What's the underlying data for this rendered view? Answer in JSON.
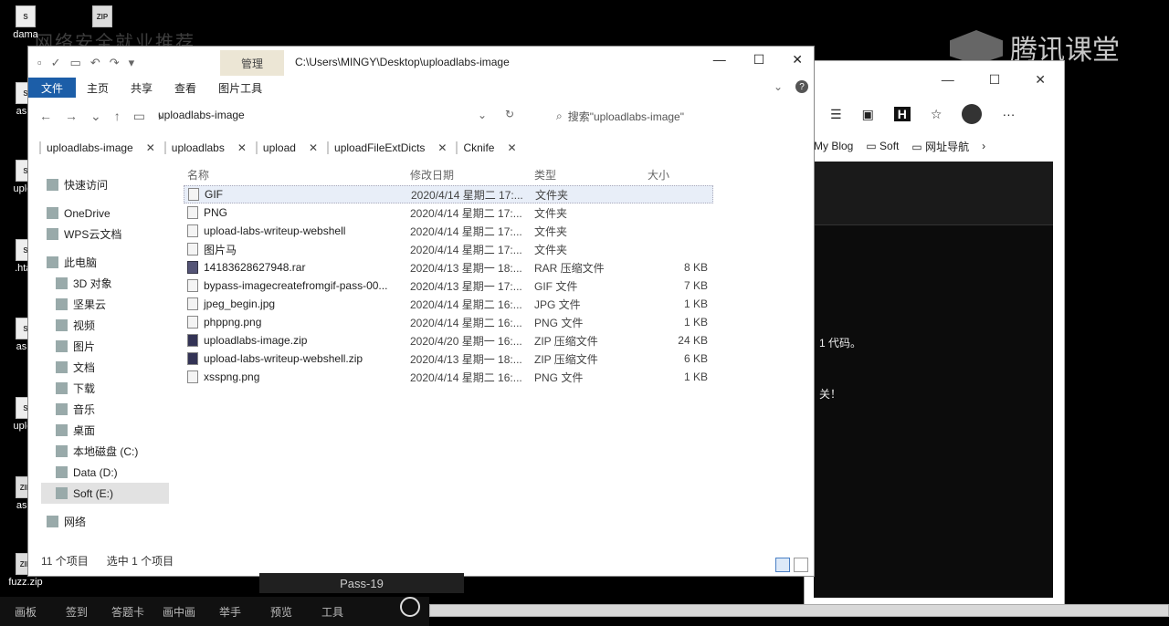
{
  "desktop": {
    "icons": [
      {
        "label": "dama",
        "type": "S"
      },
      {
        "label": "",
        "type": "ZIP"
      },
      {
        "label": "as.p",
        "type": "S"
      },
      {
        "label": "uploa",
        "type": "S"
      },
      {
        "label": ".htac",
        "type": "S"
      },
      {
        "label": "as.p",
        "type": "S"
      },
      {
        "label": "uploa",
        "type": "S"
      },
      {
        "label": "as.z",
        "type": "ZIP"
      },
      {
        "label": "fuzz.zip",
        "type": "ZIP"
      }
    ],
    "watermark": "网络安全就业推荐",
    "brand": "腾讯课堂"
  },
  "explorer": {
    "quick_access": [
      "▫",
      "✓",
      "▭",
      "↶",
      "↷",
      "▾"
    ],
    "manage_tab": "管理",
    "title_path": "C:\\Users\\MINGY\\Desktop\\uploadlabs-image",
    "window_buttons": [
      "—",
      "☐",
      "✕"
    ],
    "ribbon_tabs": [
      "文件",
      "主页",
      "共享",
      "查看",
      "图片工具"
    ],
    "address": "uploadlabs-image",
    "search_placeholder": "搜索\"uploadlabs-image\"",
    "folder_tabs": [
      "uploadlabs-image",
      "uploadlabs",
      "upload",
      "uploadFileExtDicts",
      "Cknife"
    ],
    "sidebar": [
      {
        "label": "快速访问",
        "selected": false
      },
      {
        "label": "OneDrive",
        "selected": false
      },
      {
        "label": "WPS云文档",
        "selected": false
      },
      {
        "label": "此电脑",
        "selected": false
      },
      {
        "label": "3D 对象",
        "selected": false
      },
      {
        "label": "坚果云",
        "selected": false
      },
      {
        "label": "视频",
        "selected": false
      },
      {
        "label": "图片",
        "selected": false
      },
      {
        "label": "文档",
        "selected": false
      },
      {
        "label": "下载",
        "selected": false
      },
      {
        "label": "音乐",
        "selected": false
      },
      {
        "label": "桌面",
        "selected": false
      },
      {
        "label": "本地磁盘 (C:)",
        "selected": false
      },
      {
        "label": "Data (D:)",
        "selected": false
      },
      {
        "label": "Soft (E:)",
        "selected": true
      },
      {
        "label": "网络",
        "selected": false
      }
    ],
    "columns": [
      "名称",
      "修改日期",
      "类型",
      "大小"
    ],
    "files": [
      {
        "name": "GIF",
        "date": "2020/4/14 星期二 17:...",
        "type": "文件夹",
        "size": "",
        "icon": "folder",
        "selected": true
      },
      {
        "name": "PNG",
        "date": "2020/4/14 星期二 17:...",
        "type": "文件夹",
        "size": "",
        "icon": "folder",
        "selected": false
      },
      {
        "name": "upload-labs-writeup-webshell",
        "date": "2020/4/14 星期二 17:...",
        "type": "文件夹",
        "size": "",
        "icon": "folder",
        "selected": false
      },
      {
        "name": "图片马",
        "date": "2020/4/14 星期二 17:...",
        "type": "文件夹",
        "size": "",
        "icon": "folder",
        "selected": false
      },
      {
        "name": "14183628627948.rar",
        "date": "2020/4/13 星期一 18:...",
        "type": "RAR 压缩文件",
        "size": "8 KB",
        "icon": "rar",
        "selected": false
      },
      {
        "name": "bypass-imagecreatefromgif-pass-00...",
        "date": "2020/4/13 星期一 17:...",
        "type": "GIF 文件",
        "size": "7 KB",
        "icon": "file",
        "selected": false
      },
      {
        "name": "jpeg_begin.jpg",
        "date": "2020/4/14 星期二 16:...",
        "type": "JPG 文件",
        "size": "1 KB",
        "icon": "file",
        "selected": false
      },
      {
        "name": "phppng.png",
        "date": "2020/4/14 星期二 16:...",
        "type": "PNG 文件",
        "size": "1 KB",
        "icon": "file",
        "selected": false
      },
      {
        "name": "uploadlabs-image.zip",
        "date": "2020/4/20 星期一 16:...",
        "type": "ZIP 压缩文件",
        "size": "24 KB",
        "icon": "zip",
        "selected": false
      },
      {
        "name": "upload-labs-writeup-webshell.zip",
        "date": "2020/4/13 星期一 18:...",
        "type": "ZIP 压缩文件",
        "size": "6 KB",
        "icon": "zip",
        "selected": false
      },
      {
        "name": "xsspng.png",
        "date": "2020/4/14 星期二 16:...",
        "type": "PNG 文件",
        "size": "1 KB",
        "icon": "file",
        "selected": false
      }
    ],
    "status_count": "11 个项目",
    "status_selected": "选中 1 个项目"
  },
  "browser": {
    "window_buttons": [
      "—",
      "☐",
      "✕"
    ],
    "fav_items": [
      "My Blog",
      "Soft",
      "网址导航"
    ],
    "page_text_1": "1 代码。",
    "page_text_2": "关！"
  },
  "bottom": {
    "pass_label": "Pass-19",
    "buttons": [
      "画板",
      "签到",
      "答题卡",
      "画中画",
      "举手",
      "预览",
      "工具"
    ]
  }
}
